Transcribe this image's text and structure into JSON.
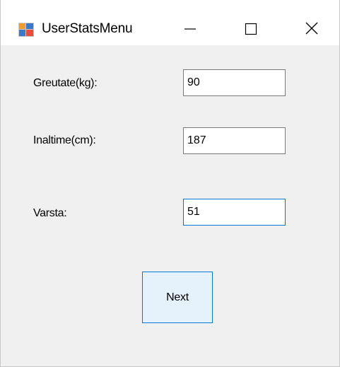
{
  "window": {
    "title": "UserStatsMenu",
    "icon": "winforms-app-icon",
    "controls": [
      "minimize-icon",
      "maximize-icon",
      "close-icon"
    ]
  },
  "form": {
    "weight": {
      "label": "Greutate(kg):",
      "value": "90"
    },
    "height": {
      "label": "Inaltime(cm):",
      "value": "187"
    },
    "age": {
      "label": "Varsta:",
      "value": "51"
    },
    "next_label": "Next"
  },
  "colors": {
    "form_background": "#f0f0f0",
    "titlebar_background": "#ffffff",
    "focus_border": "#0078d7",
    "button_background": "#e5f1fb"
  }
}
